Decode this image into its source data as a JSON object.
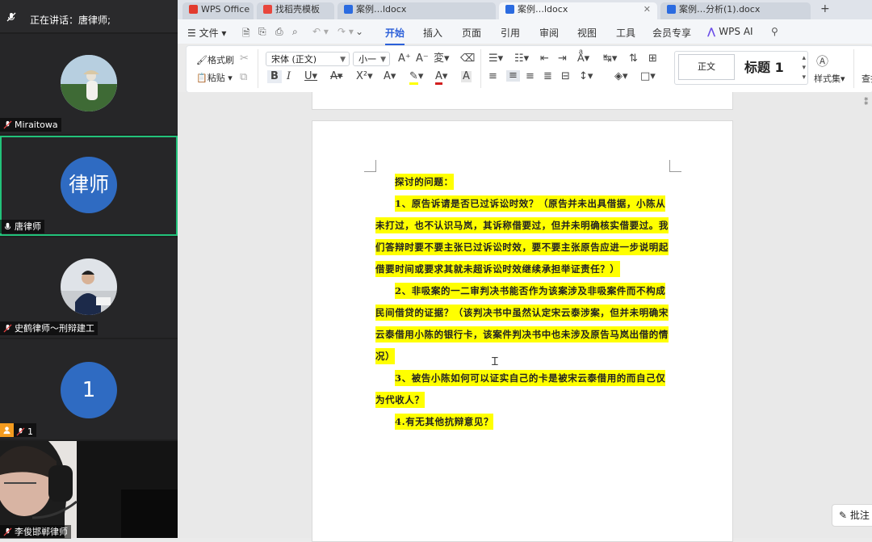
{
  "meeting": {
    "speaking_label": "正在讲话：",
    "speaking_name": "唐律师;",
    "participants": [
      {
        "name": "Miraitowa",
        "type": "photo",
        "muted": true
      },
      {
        "name": "唐律师",
        "type": "text-avatar",
        "avatar_text": "律师",
        "muted": false,
        "active": true
      },
      {
        "name": "史鹤律师～刑辩建工",
        "type": "photo",
        "muted": true
      },
      {
        "name": "1",
        "type": "text-avatar",
        "avatar_text": "1",
        "muted": true,
        "host_icon": true
      },
      {
        "name": "李俊邯郸律师",
        "type": "video",
        "muted": true
      }
    ],
    "avatar_color": "#2f6bc2",
    "active_border_color": "#22c27a"
  },
  "wps": {
    "tabs": [
      "WPS Office",
      "找稻壳模板",
      "",
      "案例…ldocx",
      "案例…ldocx",
      "案例…分析(1).docx"
    ],
    "menu": {
      "file": "文件",
      "items": [
        "开始",
        "插入",
        "页面",
        "引用",
        "审阅",
        "视图",
        "工具",
        "会员专享",
        "WPS AI"
      ],
      "selected": "开始"
    },
    "ribbon": {
      "format_painter": "格式刷",
      "paste": "粘贴",
      "font_name": "宋体 (正文)",
      "font_size": "小一",
      "style_normal": "正文",
      "style_heading": "标题 1",
      "style_set": "样式集",
      "find": "查找"
    },
    "accent_color": "#2b5fd9"
  },
  "document": {
    "highlight_color": "#ffff00",
    "paragraphs": [
      "探讨的问题：",
      "1、原告诉请是否已过诉讼时效？（原告并未出具借据，小陈从未打过，也不认识马岚，其诉称借要过，但并未明确核实借要过。我们答辩时要不要主张已过诉讼时效，要不要主张原告应进一步说明起借要时间或要求其就未超诉讼时效继续承担举证责任？）",
      "2、非吸案的一二审判决书能否作为该案涉及非吸案件而不构成民间借贷的证据？（该判决书中虽然认定宋云泰涉案，但并未明确宋云泰借用小陈的银行卡，该案件判决书中也未涉及原告马岚出借的情况）",
      "3、被告小陈如何可以证实自己的卡是被宋云泰借用的而自己仅为代收人？",
      "4.有无其他抗辩意见？"
    ]
  },
  "comment_button": "批注"
}
